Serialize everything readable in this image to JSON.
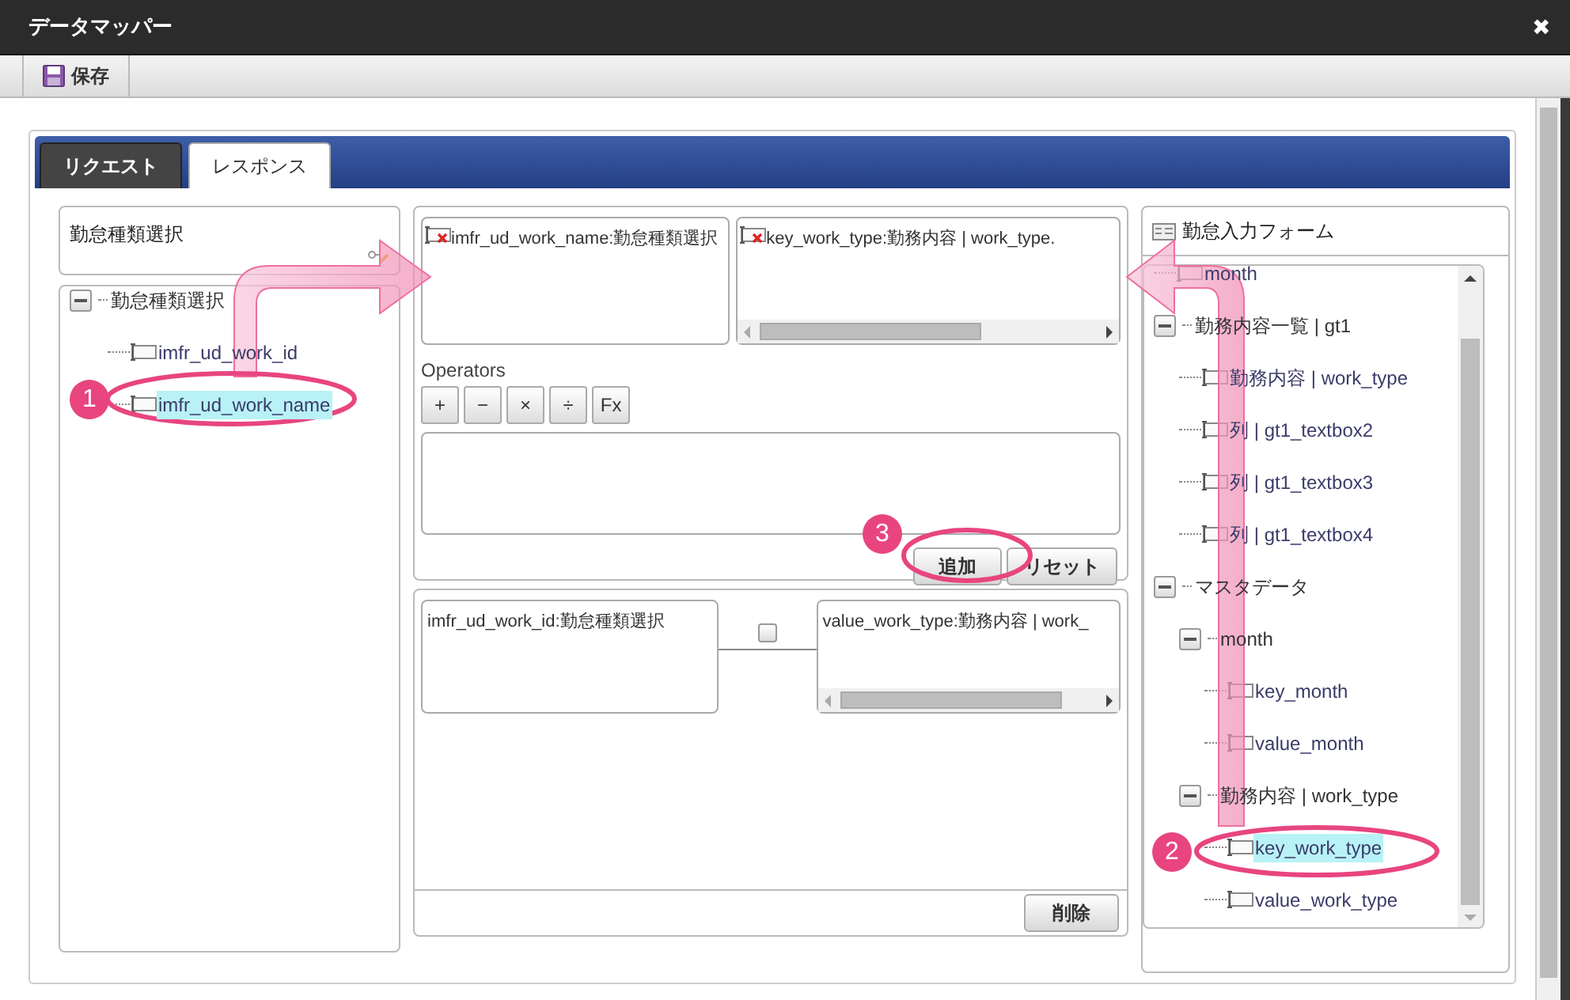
{
  "window": {
    "title": "データマッパー",
    "close": "✖"
  },
  "toolbar": {
    "save": "保存"
  },
  "tabs": [
    {
      "label": "リクエスト",
      "selected": false
    },
    {
      "label": "レスポンス",
      "selected": true
    }
  ],
  "source": {
    "title": "勤怠種類選択",
    "tree": [
      {
        "label": "勤怠種類選択",
        "expanded": true,
        "children": [
          {
            "label": "imfr_ud_work_id",
            "selected": false
          },
          {
            "label": "imfr_ud_work_name",
            "selected": true
          }
        ]
      }
    ]
  },
  "expression": {
    "source_field": "imfr_ud_work_name:勤怠種類選択",
    "target_field": "key_work_type:勤務内容 | work_type.",
    "operators_label": "Operators",
    "operators": [
      "+",
      "−",
      "×",
      "÷",
      "Fx"
    ],
    "buttons": [
      "追加",
      "リセット"
    ]
  },
  "mappings": [
    {
      "source": "imfr_ud_work_id:勤怠種類選択",
      "target": "value_work_type:勤務内容 | work_",
      "checked": false
    }
  ],
  "mapping_buttons": [
    "削除"
  ],
  "target": {
    "title": "勤怠入力フォーム",
    "tree": [
      {
        "label": "month",
        "selected": false
      },
      {
        "label": "勤務内容一覧 | gt1",
        "expanded": true,
        "children": [
          {
            "label": "勤務内容 | work_type",
            "selected": false
          },
          {
            "label": "列 | gt1_textbox2",
            "selected": false
          },
          {
            "label": "列 | gt1_textbox3",
            "selected": false
          },
          {
            "label": "列 | gt1_textbox4",
            "selected": false
          }
        ]
      },
      {
        "label": "マスタデータ",
        "expanded": true,
        "children": [
          {
            "label": "month",
            "expanded": true,
            "children": [
              {
                "label": "key_month",
                "selected": false
              },
              {
                "label": "value_month",
                "selected": false
              }
            ]
          },
          {
            "label": "勤務内容 | work_type",
            "expanded": true,
            "children": [
              {
                "label": "key_work_type",
                "selected": true
              },
              {
                "label": "value_work_type",
                "selected": false
              }
            ]
          }
        ]
      }
    ]
  },
  "annotations": [
    {
      "number": "1"
    },
    {
      "number": "2"
    },
    {
      "number": "3"
    }
  ]
}
